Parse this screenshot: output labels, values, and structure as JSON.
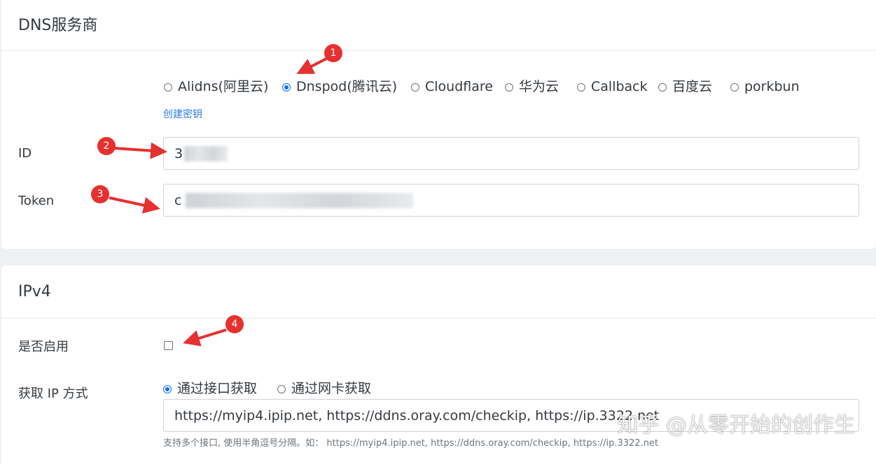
{
  "dns": {
    "title": "DNS服务商",
    "providers": [
      {
        "label": "Alidns(阿里云)",
        "checked": false
      },
      {
        "label": "Dnspod(腾讯云)",
        "checked": true
      },
      {
        "label": "Cloudflare",
        "checked": false
      },
      {
        "label": "华为云",
        "checked": false
      },
      {
        "label": "Callback",
        "checked": false
      },
      {
        "label": "百度云",
        "checked": false
      },
      {
        "label": "porkbun",
        "checked": false
      }
    ],
    "create_key_link": "创建密钥",
    "id_label": "ID",
    "id_value_prefix": "3",
    "token_label": "Token",
    "token_value_prefix": "c"
  },
  "ipv4": {
    "title": "IPv4",
    "enable_label": "是否启用",
    "enable_checked": false,
    "method_label": "获取 IP 方式",
    "methods": [
      {
        "label": "通过接口获取",
        "checked": true
      },
      {
        "label": "通过网卡获取",
        "checked": false
      }
    ],
    "url_value": "https://myip4.ipip.net, https://ddns.oray.com/checkip, https://ip.3322.net",
    "help_text": "支持多个接口, 使用半角逗号分隔。如：  https://myip4.ipip.net, https://ddns.oray.com/checkip, https://ip.3322.net"
  },
  "annotations": [
    "1",
    "2",
    "3",
    "4"
  ],
  "annotation_color": "#e5312f",
  "accent_color": "#0d6efd",
  "watermark": "知乎 @从零开始的创作生"
}
